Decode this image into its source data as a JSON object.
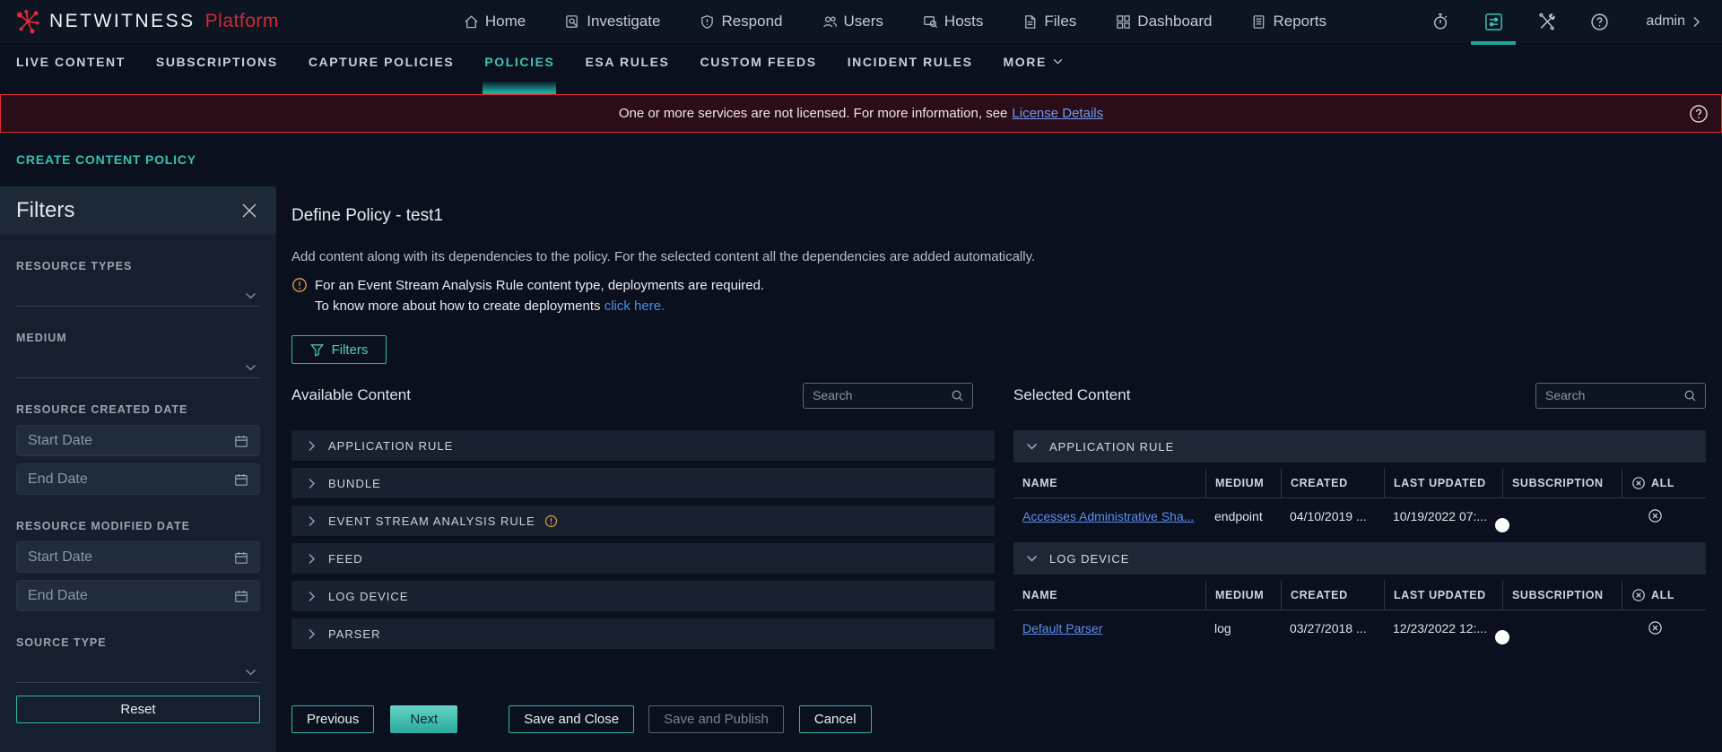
{
  "topbar": {
    "brand": {
      "name": "NETWITNESS",
      "suffix": "Platform"
    },
    "nav": [
      {
        "label": "Home"
      },
      {
        "label": "Investigate"
      },
      {
        "label": "Respond"
      },
      {
        "label": "Users"
      },
      {
        "label": "Hosts"
      },
      {
        "label": "Files"
      },
      {
        "label": "Dashboard"
      },
      {
        "label": "Reports"
      }
    ],
    "right": {
      "admin_label": "admin"
    }
  },
  "subnav": {
    "items": [
      {
        "label": "LIVE CONTENT",
        "active": false
      },
      {
        "label": "SUBSCRIPTIONS",
        "active": false
      },
      {
        "label": "CAPTURE POLICIES",
        "active": false
      },
      {
        "label": "POLICIES",
        "active": true
      },
      {
        "label": "ESA RULES",
        "active": false
      },
      {
        "label": "CUSTOM FEEDS",
        "active": false
      },
      {
        "label": "INCIDENT RULES",
        "active": false
      },
      {
        "label": "MORE",
        "active": false
      }
    ]
  },
  "banner": {
    "text": "One or more services are not licensed. For more information, see",
    "link": "License Details"
  },
  "page": {
    "title": "CREATE CONTENT POLICY"
  },
  "filters_panel": {
    "title": "Filters",
    "resource_types_label": "RESOURCE TYPES",
    "medium_label": "MEDIUM",
    "resource_created_label": "RESOURCE CREATED DATE",
    "resource_modified_label": "RESOURCE MODIFIED DATE",
    "source_type_label": "SOURCE TYPE",
    "start_date_placeholder": "Start Date",
    "end_date_placeholder": "End Date",
    "reset_label": "Reset"
  },
  "main": {
    "title": "Define Policy - test1",
    "description": "Add content along with its dependencies to the policy. For the selected content all the dependencies are added automatically.",
    "warning_line1": "For an Event Stream Analysis Rule content type, deployments are required.",
    "warning_line2": "To know more about how to create deployments",
    "warning_link": "click here.",
    "filters_button": "Filters",
    "available": {
      "title": "Available Content",
      "search_placeholder": "Search",
      "rows": [
        {
          "label": "APPLICATION RULE"
        },
        {
          "label": "BUNDLE"
        },
        {
          "label": "EVENT STREAM ANALYSIS RULE"
        },
        {
          "label": "FEED"
        },
        {
          "label": "LOG DEVICE"
        },
        {
          "label": "PARSER"
        }
      ]
    },
    "selected": {
      "title": "Selected Content",
      "search_placeholder": "Search",
      "columns": {
        "name": "NAME",
        "medium": "MEDIUM",
        "created": "CREATED",
        "last_updated": "LAST UPDATED",
        "subscription": "SUBSCRIPTION",
        "all": "ALL"
      },
      "groups": [
        {
          "name": "APPLICATION RULE",
          "rows": [
            {
              "name": "Accesses Administrative Sha...",
              "medium": "endpoint",
              "created": "04/10/2019 ...",
              "last_updated": "10/19/2022 07:...",
              "subscription": "on"
            }
          ]
        },
        {
          "name": "LOG DEVICE",
          "rows": [
            {
              "name": "Default Parser",
              "medium": "log",
              "created": "03/27/2018 ...",
              "last_updated": "12/23/2022 12:...",
              "subscription": "on"
            }
          ]
        }
      ]
    },
    "actions": {
      "previous": "Previous",
      "next": "Next",
      "save_close": "Save and Close",
      "save_publish": "Save and Publish",
      "cancel": "Cancel"
    }
  },
  "icons": [
    "netwitness-logo-icon",
    "home-icon",
    "investigate-icon",
    "respond-icon",
    "users-icon",
    "hosts-icon",
    "files-icon",
    "dashboard-icon",
    "reports-icon",
    "timer-icon",
    "admin-settings-icon",
    "tools-icon",
    "help-icon",
    "chevron-right-icon",
    "chevron-down-icon",
    "close-icon",
    "calendar-icon",
    "search-icon",
    "funnel-icon",
    "warning-icon",
    "remove-all-icon",
    "remove-icon"
  ],
  "colors": {
    "accent_teal": "#2eb6a8",
    "active_tab_teal": "#3ec3b6",
    "banner_red": "#e02b38",
    "banner_bg": "#2a0d17",
    "link_blue": "#5e8ef2",
    "banner_link_blue": "#6e9af5",
    "warning_orange": "#e8a33d",
    "brand_red": "#cf2a36",
    "toggle_on": "#2eb6a8"
  }
}
